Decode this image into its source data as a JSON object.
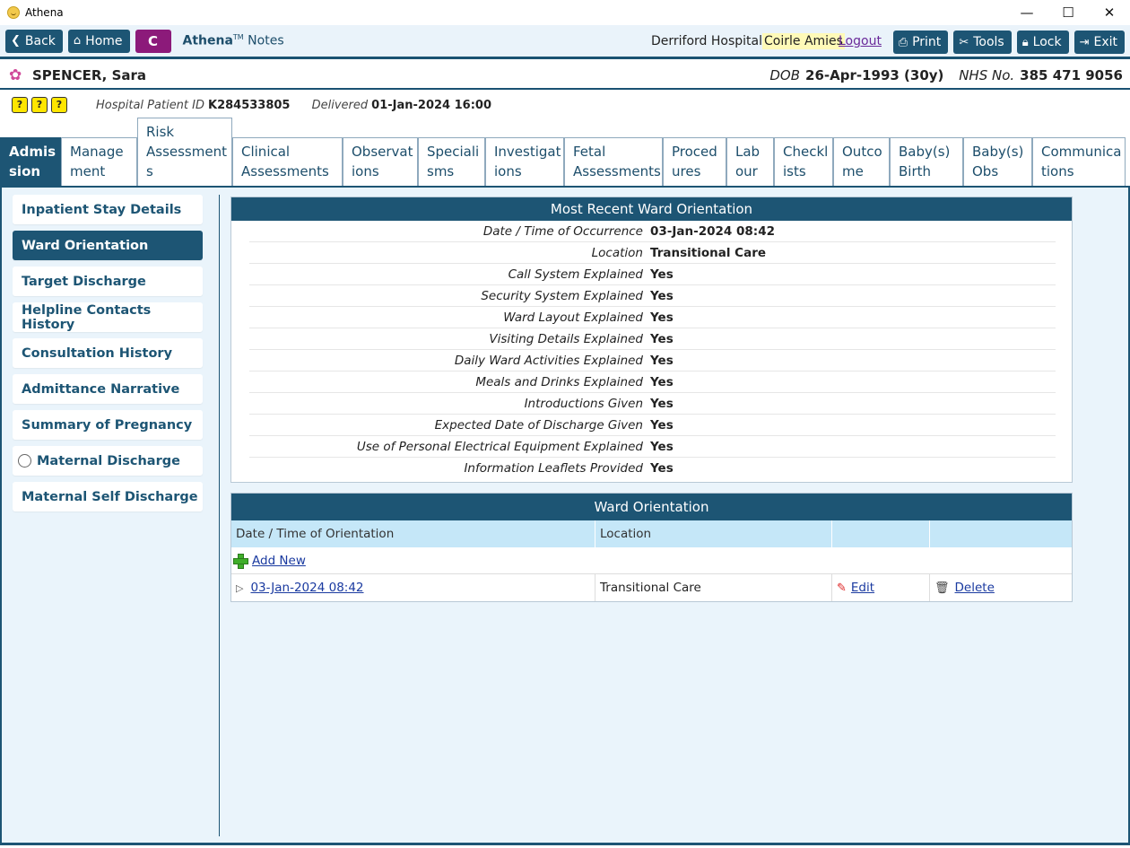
{
  "window": {
    "title": "Athena",
    "minimize": "—",
    "maximize": "☐",
    "close": "✕"
  },
  "toolbar": {
    "back": "Back",
    "home": "Home",
    "c_label": "C",
    "brand_name": "Athena",
    "brand_tm": "TM",
    "brand_suffix": "Notes",
    "hospital": "Derriford Hospital",
    "user": "Coirle Amies",
    "logout": "Logout",
    "print": "Print",
    "tools": "Tools",
    "lock": "Lock",
    "exit": "Exit"
  },
  "patient": {
    "name": "SPENCER, Sara",
    "dob_label": "DOB",
    "dob": "26-Apr-1993 (30y)",
    "nhs_label": "NHS No.",
    "nhs": "385 471 9056"
  },
  "info": {
    "hosp_id_label": "Hospital Patient ID",
    "hosp_id": "K284533805",
    "delivered_label": "Delivered",
    "delivered": "01-Jan-2024 16:00",
    "quick_icons": [
      "?",
      "?",
      "?"
    ]
  },
  "tabs": [
    {
      "l1": "Admis",
      "l2": "sion"
    },
    {
      "l1": "Manage",
      "l2": "ment"
    },
    {
      "l1": "Risk",
      "l2": "Assessment",
      "l3": "s"
    },
    {
      "l1": "Clinical",
      "l2": "Assessments"
    },
    {
      "l1": "Observat",
      "l2": "ions"
    },
    {
      "l1": "Speciali",
      "l2": "sms"
    },
    {
      "l1": "Investigat",
      "l2": "ions"
    },
    {
      "l1": "Fetal",
      "l2": "Assessments"
    },
    {
      "l1": "Proced",
      "l2": "ures"
    },
    {
      "l1": "Lab",
      "l2": "our"
    },
    {
      "l1": "Checkl",
      "l2": "ists"
    },
    {
      "l1": "Outco",
      "l2": "me"
    },
    {
      "l1": "Baby(s)",
      "l2": "Birth"
    },
    {
      "l1": "Baby(s)",
      "l2": "Obs"
    },
    {
      "l1": "Communica",
      "l2": "tions"
    }
  ],
  "nav": [
    "Inpatient Stay Details",
    "Ward Orientation",
    "Target Discharge",
    "Helpline Contacts History",
    "Consultation History",
    "Admittance Narrative",
    "Summary of Pregnancy",
    "Maternal Discharge",
    "Maternal Self Discharge"
  ],
  "recent": {
    "title": "Most Recent Ward Orientation",
    "rows": [
      {
        "k": "Date / Time of Occurrence",
        "v": "03-Jan-2024 08:42"
      },
      {
        "k": "Location",
        "v": "Transitional Care"
      },
      {
        "k": "Call System Explained",
        "v": "Yes"
      },
      {
        "k": "Security System Explained",
        "v": "Yes"
      },
      {
        "k": "Ward Layout Explained",
        "v": "Yes"
      },
      {
        "k": "Visiting Details Explained",
        "v": "Yes"
      },
      {
        "k": "Daily Ward Activities Explained",
        "v": "Yes"
      },
      {
        "k": "Meals and Drinks Explained",
        "v": "Yes"
      },
      {
        "k": "Introductions Given",
        "v": "Yes"
      },
      {
        "k": "Expected Date of Discharge Given",
        "v": "Yes"
      },
      {
        "k": "Use of Personal Electrical Equipment Explained",
        "v": "Yes"
      },
      {
        "k": "Information Leaflets Provided",
        "v": "Yes"
      }
    ]
  },
  "table": {
    "title": "Ward Orientation",
    "headers": [
      "Date / Time of Orientation",
      "Location",
      "",
      ""
    ],
    "add_new": "Add New",
    "rows": [
      {
        "date": "03-Jan-2024 08:42",
        "location": "Transitional Care",
        "edit": "Edit",
        "delete": "Delete"
      }
    ]
  }
}
